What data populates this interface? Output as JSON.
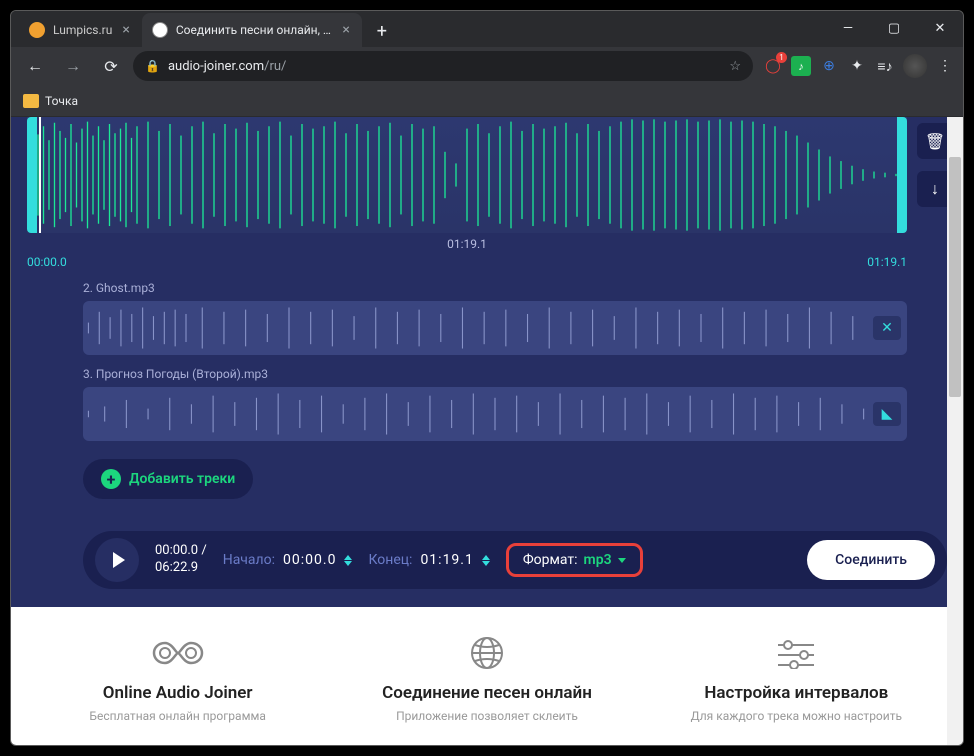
{
  "tabs": [
    {
      "title": "Lumpics.ru",
      "favicon_color": "#f0a030"
    },
    {
      "title": "Соединить песни онлайн, скле...",
      "favicon_color": "#ffffff"
    }
  ],
  "address": {
    "domain": "audio-joiner.com",
    "path": "/ru/"
  },
  "bookmarks": {
    "item1": "Точка"
  },
  "editor": {
    "track1": {
      "duration": "01:19.1",
      "start_time": "00:00.0",
      "end_time": "01:19.1"
    },
    "track2": {
      "label": "2. Ghost.mp3"
    },
    "track3": {
      "label": "3. Прогноз Погоды (Второй).mp3"
    },
    "add_button": "Добавить треки"
  },
  "controls": {
    "pos_current": "00:00.0 /",
    "pos_total": "06:22.9",
    "start_label": "Начало:",
    "start_val": "00:00.0",
    "end_label": "Конец:",
    "end_val": "01:19.1",
    "format_label": "Формат:",
    "format_val": "mp3",
    "join_label": "Соединить"
  },
  "features": {
    "f1": {
      "title": "Online Audio Joiner",
      "desc": "Бесплатная онлайн программа"
    },
    "f2": {
      "title": "Соединение песен онлайн",
      "desc": "Приложение позволяет склеить"
    },
    "f3": {
      "title": "Настройка интервалов",
      "desc": "Для каждого трека можно настроить"
    }
  },
  "ext_badge": "1"
}
